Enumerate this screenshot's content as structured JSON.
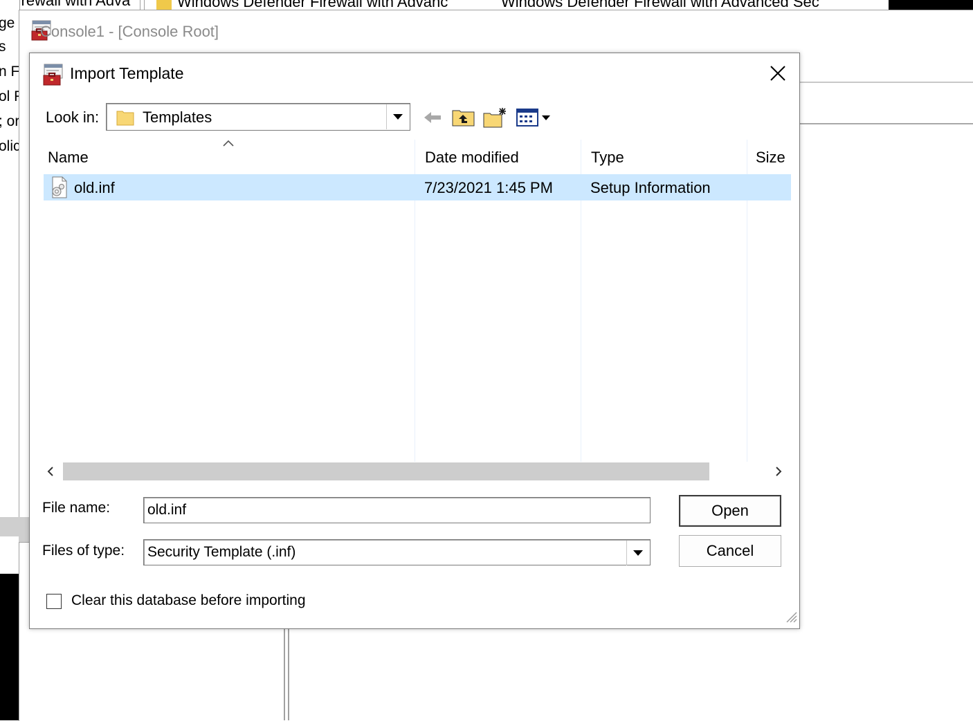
{
  "background": {
    "left_fragments": [
      "ge",
      "s",
      "n F",
      "ol F",
      "; or",
      "olic"
    ],
    "top_fragment_1": "I Firewall with Adva",
    "top_fragment_2": "Windows Defender Firewall with Advanc",
    "top_fragment_3": "Windows Defender Firewall with Advanced Sec"
  },
  "console": {
    "title": "Console1 - [Console Root]",
    "icon": "mmc-toolbox-icon"
  },
  "dialog": {
    "title": "Import Template",
    "icon": "mmc-toolbox-icon",
    "look_in_label": "Look in:",
    "look_in_value": "Templates",
    "toolbar": [
      "back-arrow-icon",
      "up-one-level-icon",
      "new-folder-icon",
      "view-menu-icon"
    ],
    "columns": [
      "Name",
      "Date modified",
      "Type",
      "Size"
    ],
    "files": [
      {
        "name": "old.inf",
        "date_modified": "7/23/2021 1:45 PM",
        "type": "Setup Information",
        "size": "",
        "selected": true
      }
    ],
    "file_name_label": "File name:",
    "file_name_value": "old.inf",
    "files_of_type_label": "Files of type:",
    "files_of_type_value": "Security Template (.inf)",
    "open_label": "Open",
    "cancel_label": "Cancel",
    "clear_db_label": "Clear this database before importing",
    "clear_db_checked": false
  },
  "colors": {
    "selection": "#cce8ff",
    "folder": "#f8d775",
    "icon_red": "#c0282b"
  }
}
